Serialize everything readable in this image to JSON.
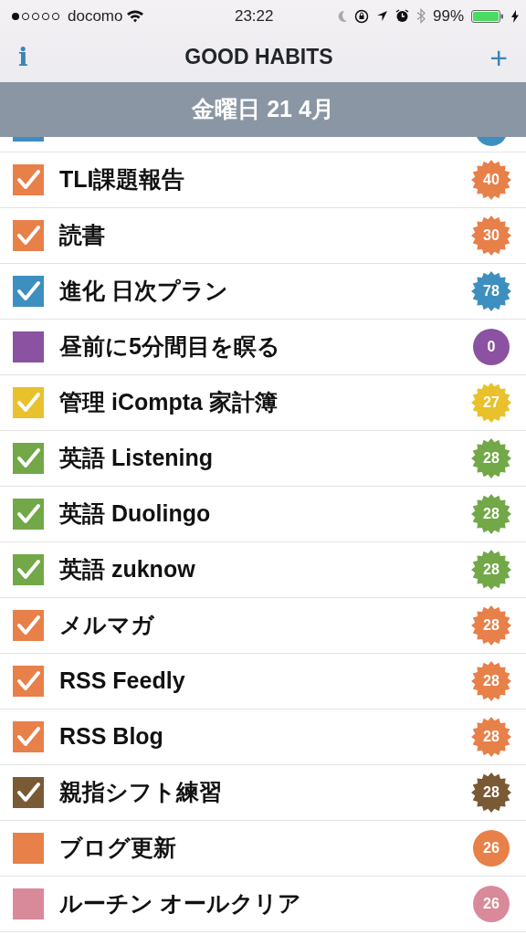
{
  "status_bar": {
    "carrier": "docomo",
    "time": "23:22",
    "battery": "99%"
  },
  "nav": {
    "info_button": "i",
    "title": "GOOD HABITS",
    "add_button": "+"
  },
  "date_bar": {
    "label": "金曜日 21 4月"
  },
  "clipped_row": {
    "color": "#3d8fc0"
  },
  "habits": [
    {
      "name": "TLI課題報告",
      "checked": true,
      "count": "40",
      "color": "#e8804a"
    },
    {
      "name": "読書",
      "checked": true,
      "count": "30",
      "color": "#e8804a"
    },
    {
      "name": "進化 日次プラン",
      "checked": true,
      "count": "78",
      "color": "#3d8fc0"
    },
    {
      "name": "昼前に5分間目を瞑る",
      "checked": false,
      "count": "0",
      "color": "#8a52a0"
    },
    {
      "name": "管理 iCompta 家計簿",
      "checked": true,
      "count": "27",
      "color": "#e8c12d"
    },
    {
      "name": "英語 Listening",
      "checked": true,
      "count": "28",
      "color": "#72a848"
    },
    {
      "name": "英語 Duolingo",
      "checked": true,
      "count": "28",
      "color": "#72a848"
    },
    {
      "name": "英語 zuknow",
      "checked": true,
      "count": "28",
      "color": "#72a848"
    },
    {
      "name": "メルマガ",
      "checked": true,
      "count": "28",
      "color": "#e8804a"
    },
    {
      "name": "RSS Feedly",
      "checked": true,
      "count": "28",
      "color": "#e8804a"
    },
    {
      "name": "RSS Blog",
      "checked": true,
      "count": "28",
      "color": "#e8804a"
    },
    {
      "name": "親指シフト練習",
      "checked": true,
      "count": "28",
      "color": "#7a5a35"
    },
    {
      "name": "ブログ更新",
      "checked": false,
      "count": "26",
      "color": "#e8804a"
    },
    {
      "name": "ルーチン オールクリア",
      "checked": false,
      "count": "26",
      "color": "#d98a9a"
    }
  ]
}
